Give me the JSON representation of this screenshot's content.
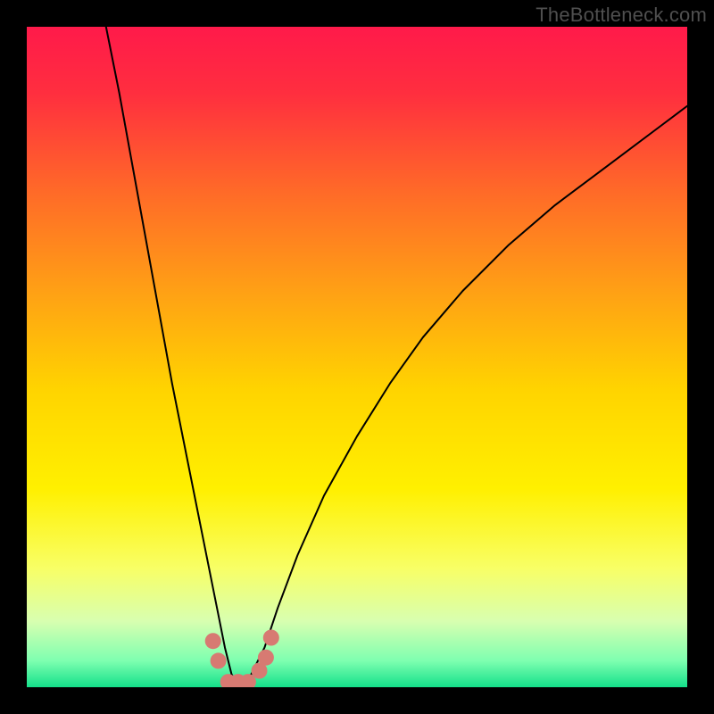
{
  "watermark": "TheBottleneck.com",
  "chart_data": {
    "type": "line",
    "title": "",
    "xlabel": "",
    "ylabel": "",
    "xlim": [
      0,
      100
    ],
    "ylim": [
      0,
      100
    ],
    "grid": false,
    "legend": false,
    "background": {
      "type": "vertical-gradient",
      "stops": [
        {
          "pos": 0.0,
          "color": "#ff1a4a"
        },
        {
          "pos": 0.1,
          "color": "#ff2e3f"
        },
        {
          "pos": 0.25,
          "color": "#ff6a28"
        },
        {
          "pos": 0.4,
          "color": "#ffa015"
        },
        {
          "pos": 0.55,
          "color": "#ffd400"
        },
        {
          "pos": 0.7,
          "color": "#fff000"
        },
        {
          "pos": 0.82,
          "color": "#f8ff66"
        },
        {
          "pos": 0.9,
          "color": "#d8ffb0"
        },
        {
          "pos": 0.96,
          "color": "#7effb0"
        },
        {
          "pos": 1.0,
          "color": "#14e08a"
        }
      ]
    },
    "series": [
      {
        "name": "bottleneck-curve",
        "stroke": "#000000",
        "stroke_width": 2,
        "x": [
          12,
          14,
          16,
          18,
          20,
          22,
          24,
          26,
          28,
          29,
          30,
          31,
          32,
          33,
          34,
          36,
          38,
          41,
          45,
          50,
          55,
          60,
          66,
          73,
          80,
          88,
          96,
          100
        ],
        "y": [
          100,
          90,
          79,
          68,
          57,
          46,
          36,
          26,
          16,
          11,
          6,
          2,
          0,
          0,
          2,
          6,
          12,
          20,
          29,
          38,
          46,
          53,
          60,
          67,
          73,
          79,
          85,
          88
        ]
      }
    ],
    "markers": {
      "name": "valley-dots",
      "fill": "#d77a72",
      "radius": 9,
      "points": [
        {
          "x": 28.2,
          "y": 7.0
        },
        {
          "x": 29.0,
          "y": 4.0
        },
        {
          "x": 30.5,
          "y": 0.8
        },
        {
          "x": 32.0,
          "y": 0.8
        },
        {
          "x": 33.5,
          "y": 0.8
        },
        {
          "x": 35.2,
          "y": 2.5
        },
        {
          "x": 36.2,
          "y": 4.5
        },
        {
          "x": 37.0,
          "y": 7.5
        }
      ]
    }
  }
}
